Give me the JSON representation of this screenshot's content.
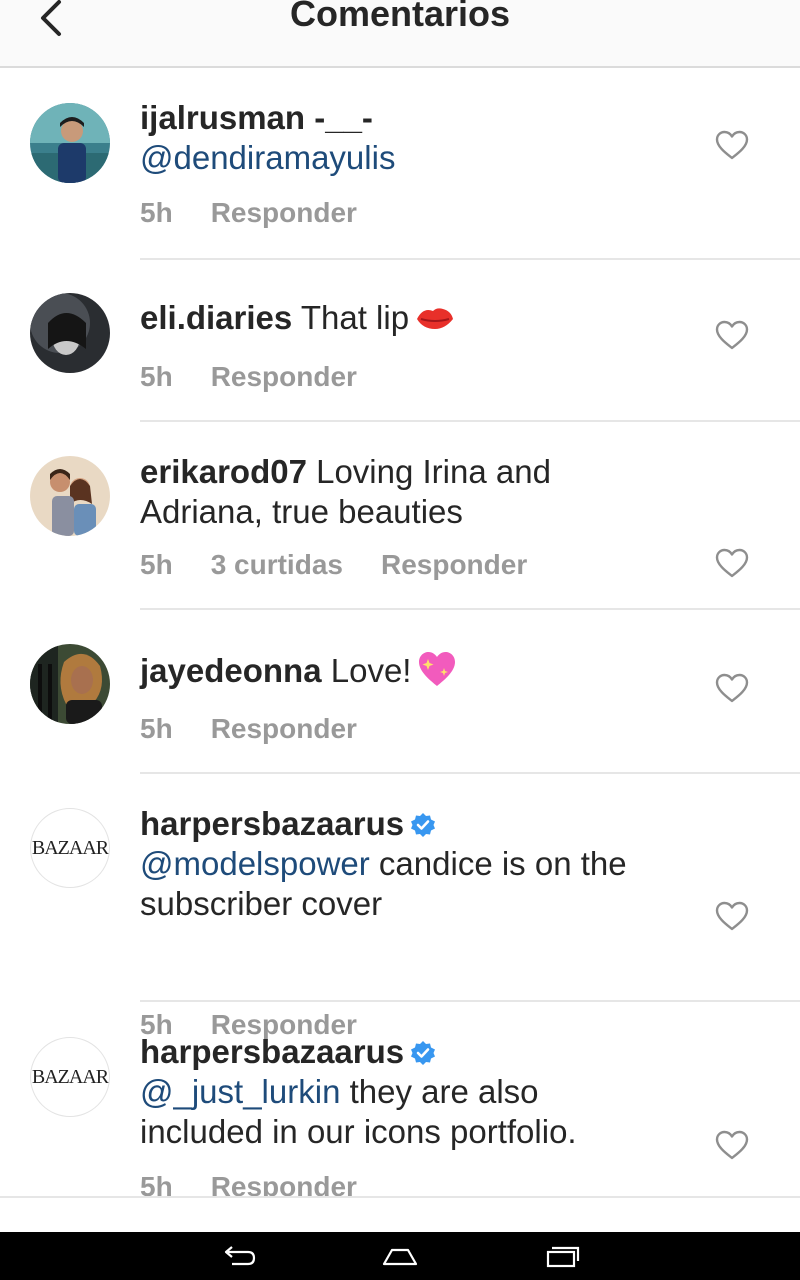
{
  "header": {
    "title": "Comentarios",
    "back_icon": "chevron-left-icon"
  },
  "comments": [
    {
      "username": "ijalrusman -__-",
      "mention": "@dendiramayulis",
      "text": "",
      "time": "5h",
      "likes": "",
      "reply_label": "Responder",
      "avatar": "photo-man-outdoor"
    },
    {
      "username": "eli.diaries",
      "mention": "",
      "text": " That lip",
      "emoji": "kiss-mark-emoji",
      "time": "5h",
      "likes": "",
      "reply_label": "Responder",
      "avatar": "photo-dark-portrait"
    },
    {
      "username": "erikarod07",
      "mention": "",
      "text": " Loving Irina and Adriana, true beauties",
      "time": "5h",
      "likes": "3 curtidas",
      "reply_label": "Responder",
      "avatar": "photo-couple"
    },
    {
      "username": "jayedeonna",
      "mention": "",
      "text": " Love!",
      "emoji": "sparkling-heart-emoji",
      "time": "5h",
      "likes": "",
      "reply_label": "Responder",
      "avatar": "photo-woman-curly-hair"
    },
    {
      "username": "harpersbazaarus",
      "verified": true,
      "mention": "@modelspower",
      "text": " candice is on the subscriber cover",
      "time": "5h",
      "likes": "",
      "reply_label": "Responder",
      "avatar": "bazaar-logo",
      "avatar_logo_text": "BAZAAR"
    },
    {
      "username": "harpersbazaarus",
      "verified": true,
      "mention": "@_just_lurkin",
      "text": " they are also included in our icons portfolio.",
      "time": "5h",
      "likes": "",
      "reply_label": "Responder",
      "avatar": "bazaar-logo",
      "avatar_logo_text": "BAZAAR"
    }
  ],
  "nav_bar": {
    "back_icon": "android-back-icon",
    "home_icon": "android-home-icon",
    "recents_icon": "android-recents-icon"
  },
  "colors": {
    "mention": "#1e4b7a",
    "verified": "#3897f0",
    "meta": "#999999"
  }
}
